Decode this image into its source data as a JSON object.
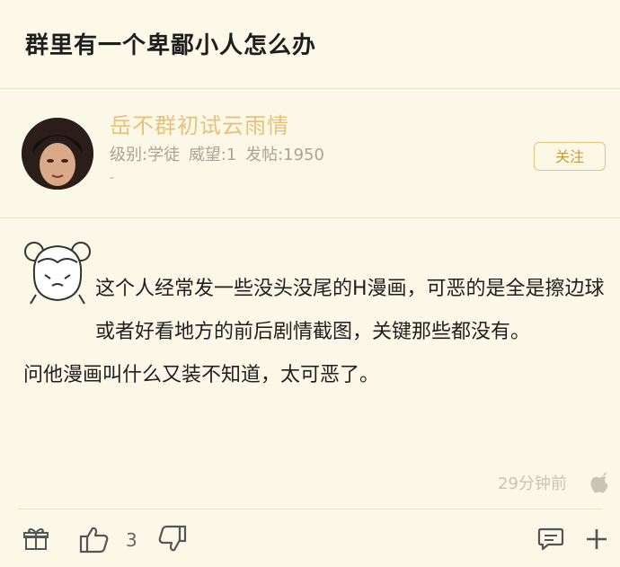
{
  "post": {
    "title": "群里有一个卑鄙小人怎么办",
    "author": {
      "nickname": "岳不群初试云雨情",
      "level": "级别:学徒",
      "prestige": "威望:1",
      "posts": "发帖:1950",
      "signature": "-"
    },
    "follow_label": "关注",
    "content": {
      "line1": "这个人经常发一些没头没尾的H漫画，可恶的是全是擦边球或者好看地方的前后剧情截图，关键那些都没有。",
      "line2": "问他漫画叫什么又装不知道，太可恶了。"
    },
    "time": "29分钟前",
    "likes": "3"
  },
  "colors": {
    "background": "#fbf8e7",
    "accent": "#e8c17b",
    "follow_text": "#c69a45"
  },
  "icons": [
    "gift-icon",
    "thumbs-up-icon",
    "thumbs-down-icon",
    "comment-icon",
    "plus-icon",
    "apple-icon"
  ]
}
